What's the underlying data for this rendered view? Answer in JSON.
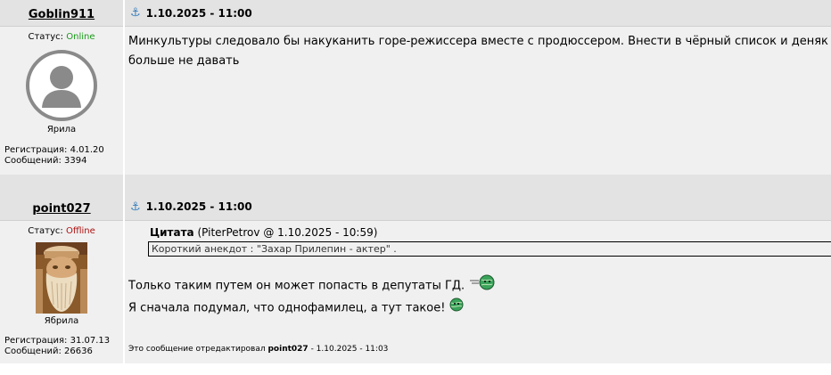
{
  "posts": [
    {
      "username": "Goblin911",
      "date": "1.10.2025 - 11:00",
      "status_label": "Статус:",
      "status_value": "Online",
      "rank": "Ярила",
      "reg_line": "Регистрация: 4.01.20",
      "msgs_line": "Сообщений: 3394",
      "text_line1": "Минкультуры следовало бы накуканить горе-режиссера вместе с продюссером. Внести в чёрный список и деняк",
      "text_line2": "больше не давать",
      "avatar": "default-user-silhouette"
    },
    {
      "username": "point027",
      "date": "1.10.2025 - 11:00",
      "status_label": "Статус:",
      "status_value": "Offline",
      "rank": "Ябрила",
      "reg_line": "Регистрация: 31.07.13",
      "msgs_line": "Сообщений: 26636",
      "quote_label": "Цитата",
      "quote_source": "(PiterPetrov @ 1.10.2025 - 10:59)",
      "quote_text": "Короткий анекдот :  \"Захар Прилепин - актер\" .",
      "text_line1": "Только таким путем он может попасть в депутаты ГД.",
      "text_line2": "Я сначала подумал, что однофамилец, а тут такое!",
      "edit_prefix": "Это сообщение отредактировал",
      "edit_user": "point027",
      "edit_date": "- 1.10.2025 - 11:03",
      "avatar": "bearded-carving-photo"
    }
  ],
  "icons": {
    "post_link": "anchor-icon",
    "smiley_1": "running-globe-smiley",
    "smiley_2": "globe-smiley"
  },
  "colors": {
    "online": "#1a9a1a",
    "offline": "#b01010",
    "header_bg": "#e3e3e3",
    "body_bg": "#f0f0f0",
    "anchor": "#3a7fbf"
  }
}
